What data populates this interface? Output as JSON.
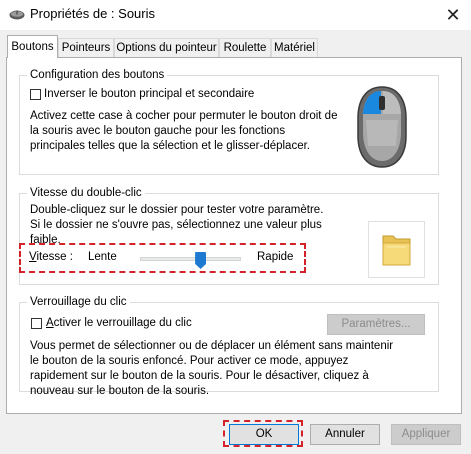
{
  "window": {
    "title": "Propriétés de : Souris",
    "close_glyph": "✕"
  },
  "tabs": [
    {
      "label": "Boutons",
      "active": true
    },
    {
      "label": "Pointeurs"
    },
    {
      "label": "Options du pointeur"
    },
    {
      "label": "Roulette"
    },
    {
      "label": "Matériel"
    }
  ],
  "button_config": {
    "title": "Configuration des boutons",
    "checkbox_label": "Inverser le bouton principal et secondaire",
    "checked": false,
    "description": "Activez cette case à cocher pour permuter le bouton droit de la souris avec le bouton gauche pour les fonctions principales telles que la sélection et le glisser-déplacer."
  },
  "double_click": {
    "title": "Vitesse du double-clic",
    "description": "Double-cliquez sur le dossier pour tester votre paramètre. Si le dossier ne s'ouvre pas, sélectionnez une valeur plus faible.",
    "speed_label": "Vitesse :",
    "slow_label": "Lente",
    "fast_label": "Rapide",
    "speed_level": 0.6
  },
  "click_lock": {
    "title": "Verrouillage du clic",
    "checkbox_label": "Activer le verrouillage du clic",
    "checked": false,
    "settings_button": "Paramètres...",
    "description": "Vous permet de sélectionner ou de déplacer un élément sans maintenir le bouton de la souris enfoncé. Pour activer ce mode, appuyez rapidement sur le bouton de la souris. Pour le désactiver, cliquez à nouveau sur le bouton de la souris."
  },
  "footer": {
    "ok": "OK",
    "cancel": "Annuler",
    "apply": "Appliquer"
  },
  "colors": {
    "highlight": "#d3222a",
    "accent": "#1e7ad0",
    "dialog_bg": "#f0f0f0"
  }
}
